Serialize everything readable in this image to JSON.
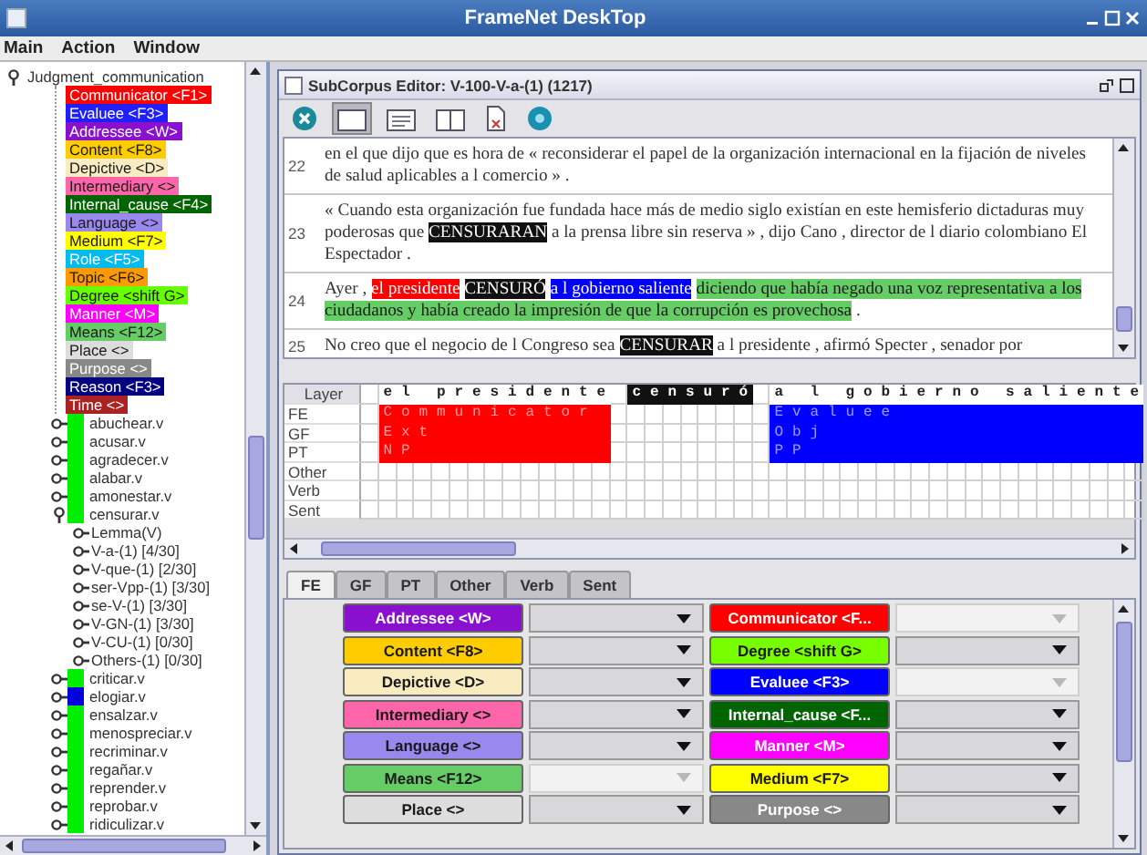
{
  "window": {
    "title": "FrameNet DeskTop"
  },
  "menu": [
    "Main",
    "Action",
    "Window"
  ],
  "tree": {
    "label": "Judgment_communication",
    "expanded": true,
    "frame_elements": [
      {
        "label": "Communicator <F1>",
        "color": "#ff0000"
      },
      {
        "label": "Evaluee <F3>",
        "color": "#2020ff"
      },
      {
        "label": "Addressee <W>",
        "color": "#8a10d0"
      },
      {
        "label": "Content <F8>",
        "color": "#ffcc00"
      },
      {
        "label": "Depictive <D>",
        "color": "#f8ecc0"
      },
      {
        "label": "Intermediary <>",
        "color": "#ff66aa"
      },
      {
        "label": "Internal_cause <F4>",
        "color": "#006400"
      },
      {
        "label": "Language <>",
        "color": "#9988ee"
      },
      {
        "label": "Medium <F7>",
        "color": "#ffff00"
      },
      {
        "label": "Role <F5>",
        "color": "#00bbee"
      },
      {
        "label": "Topic <F6>",
        "color": "#ff9900"
      },
      {
        "label": "Degree <shift G>",
        "color": "#66ff00"
      },
      {
        "label": "Manner <M>",
        "color": "#ff00ff"
      },
      {
        "label": "Means <F12>",
        "color": "#66cc66"
      },
      {
        "label": "Place <>",
        "color": "#dddddd"
      },
      {
        "label": "Purpose <>",
        "color": "#888888"
      },
      {
        "label": "Reason <F3>",
        "color": "#000080"
      },
      {
        "label": "Time <>",
        "color": "#aa2222"
      }
    ],
    "lemmas": [
      {
        "label": "abuchear.v",
        "color": "#00ee00",
        "expanded": false
      },
      {
        "label": "acusar.v",
        "color": "#00ee00",
        "expanded": false
      },
      {
        "label": "agradecer.v",
        "color": "#00ee00",
        "expanded": false
      },
      {
        "label": "alabar.v",
        "color": "#00ee00",
        "expanded": false
      },
      {
        "label": "amonestar.v",
        "color": "#00ee00",
        "expanded": false
      },
      {
        "label": "censurar.v",
        "color": "#00ee00",
        "expanded": true,
        "children": [
          {
            "label": "Lemma(V)",
            "expanded": false
          },
          {
            "label": "V-a-(1) [4/30]",
            "expanded": false
          },
          {
            "label": "V-que-(1) [2/30]",
            "expanded": false
          },
          {
            "label": "ser-Vpp-(1) [3/30]",
            "expanded": false
          },
          {
            "label": "se-V-(1) [3/30]",
            "expanded": false
          },
          {
            "label": "V-GN-(1) [3/30]",
            "expanded": false
          },
          {
            "label": "V-CU-(1) [0/30]",
            "expanded": false
          },
          {
            "label": "Others-(1) [0/30]",
            "expanded": false
          }
        ]
      },
      {
        "label": "criticar.v",
        "color": "#00ee00",
        "expanded": false
      },
      {
        "label": "elogiar.v",
        "color": "#0000dd",
        "expanded": false
      },
      {
        "label": "ensalzar.v",
        "color": "#00ee00",
        "expanded": false
      },
      {
        "label": "menospreciar.v",
        "color": "#00ee00",
        "expanded": false
      },
      {
        "label": "recriminar.v",
        "color": "#00ee00",
        "expanded": false
      },
      {
        "label": "regañar.v",
        "color": "#00ee00",
        "expanded": false
      },
      {
        "label": "reprender.v",
        "color": "#00ee00",
        "expanded": false
      },
      {
        "label": "reprobar.v",
        "color": "#00ee00",
        "expanded": false
      },
      {
        "label": "ridiculizar.v",
        "color": "#00ee00",
        "expanded": false
      }
    ]
  },
  "editor": {
    "title": "SubCorpus Editor: V-100-V-a-(1) (1217)",
    "toolbar": [
      {
        "kind": "close"
      },
      {
        "kind": "panel",
        "selected": true
      },
      {
        "kind": "checklist",
        "selected": false
      },
      {
        "kind": "split",
        "selected": false
      },
      {
        "kind": "document"
      },
      {
        "kind": "help"
      }
    ],
    "sentences": [
      {
        "number": "22",
        "segments": [
          {
            "kind": "plain",
            "text": "en el que dijo que es hora de « reconsiderar el papel de la organización internacional en la fijación de niveles de salud aplicables a l comercio » ."
          }
        ]
      },
      {
        "number": "23",
        "segments": [
          {
            "kind": "plain",
            "text": "« Cuando esta organización fue fundada hace más de medio siglo existían en este hemisferio dictaduras muy poderosas que "
          },
          {
            "kind": "target",
            "text": "CENSURARAN"
          },
          {
            "kind": "plain",
            "text": " a la prensa libre sin reserva » , dijo Cano , director de l diario colombiano El Espectador ."
          }
        ]
      },
      {
        "number": "24",
        "segments": [
          {
            "kind": "plain",
            "text": "Ayer , "
          },
          {
            "kind": "fe",
            "color": "#ff0000",
            "text": "el presidente"
          },
          {
            "kind": "space"
          },
          {
            "kind": "target",
            "text": "CENSURÓ"
          },
          {
            "kind": "space"
          },
          {
            "kind": "fe",
            "color": "#0000ff",
            "text": "a l gobierno saliente"
          },
          {
            "kind": "space"
          },
          {
            "kind": "fe",
            "color": "#66cc66",
            "text": "diciendo que había negado una voz representativa a los ciudadanos y había creado la impresión de que la corrupción es provechosa"
          },
          {
            "kind": "plain",
            "text": " ."
          }
        ]
      },
      {
        "number": "25",
        "segments": [
          {
            "kind": "plain",
            "text": "No creo que el negocio de l Congreso sea "
          },
          {
            "kind": "target",
            "text": "CENSURAR"
          },
          {
            "kind": "plain",
            "text": " a l presidente , afirmó Specter , senador por"
          }
        ]
      }
    ],
    "annotation": {
      "header": "Layer",
      "layers": [
        "FE",
        "GF",
        "PT",
        "Other",
        "Verb",
        "Sent"
      ],
      "chunks": [
        {
          "kind": "fe",
          "text": "el presidente",
          "color": "#ff0000",
          "labels": [
            "Communicator",
            "Ext",
            "NP"
          ]
        },
        {
          "kind": "target",
          "text": "censuró"
        },
        {
          "kind": "fe",
          "text": "a l gobierno saliente",
          "color": "#0000ff",
          "labels": [
            "Evaluee",
            "Obj",
            "PP"
          ]
        }
      ]
    },
    "tabs": [
      {
        "label": "FE",
        "selected": true
      },
      {
        "label": "GF",
        "selected": false
      },
      {
        "label": "PT",
        "selected": false
      },
      {
        "label": "Other",
        "selected": false
      },
      {
        "label": "Verb",
        "selected": false
      },
      {
        "label": "Sent",
        "selected": false
      }
    ],
    "fe_columns": [
      {
        "items": [
          {
            "label": "Addressee <W>",
            "color": "#8a10d0",
            "disabled": false
          },
          {
            "label": "Content <F8>",
            "color": "#ffcc00",
            "disabled": false
          },
          {
            "label": "Depictive <D>",
            "color": "#f8ecc0",
            "disabled": false
          },
          {
            "label": "Intermediary <>",
            "color": "#ff66aa",
            "disabled": false
          },
          {
            "label": "Language <>",
            "color": "#9988ee",
            "disabled": false
          },
          {
            "label": "Means <F12>",
            "color": "#66cc66",
            "disabled": true
          },
          {
            "label": "Place <>",
            "color": "#dddddd",
            "disabled": false
          }
        ]
      },
      {
        "items": [
          {
            "label": "Communicator <F...",
            "color": "#ff0000",
            "disabled": true
          },
          {
            "label": "Degree <shift G>",
            "color": "#77ff00",
            "disabled": false
          },
          {
            "label": "Evaluee <F3>",
            "color": "#0000ff",
            "disabled": true
          },
          {
            "label": "Internal_cause <F...",
            "color": "#006400",
            "disabled": false
          },
          {
            "label": "Manner <M>",
            "color": "#ff00ff",
            "disabled": false
          },
          {
            "label": "Medium <F7>",
            "color": "#ffff00",
            "disabled": false
          },
          {
            "label": "Purpose <>",
            "color": "#888888",
            "disabled": false
          }
        ]
      }
    ]
  }
}
